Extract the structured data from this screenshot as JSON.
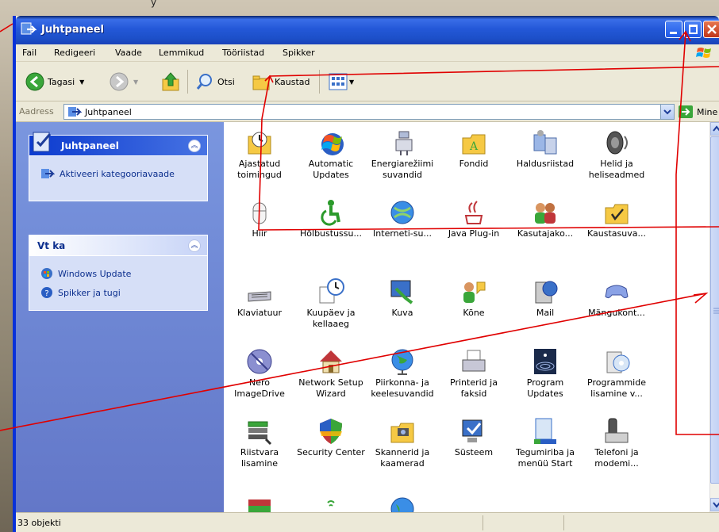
{
  "top_caption": "y",
  "window": {
    "title": "Juhtpaneel",
    "colors": {
      "titlebar": "#2458d8",
      "sidebar": "#6b83d1",
      "annotation": "#e00000"
    }
  },
  "menu": [
    "Fail",
    "Redigeeri",
    "Vaade",
    "Lemmikud",
    "Tööriistad",
    "Spikker"
  ],
  "toolbar": {
    "back": "Tagasi",
    "search": "Otsi",
    "folders": "Kaustad"
  },
  "address": {
    "label": "Aadress",
    "value": "Juhtpaneel",
    "go": "Mine"
  },
  "sidebar": {
    "box1": {
      "title": "Juhtpaneel",
      "link": "Aktiveeri kategooriavaade"
    },
    "box2": {
      "title": "Vt ka",
      "links": [
        "Windows Update",
        "Spikker ja tugi"
      ]
    }
  },
  "items": [
    {
      "label": "Ajastatud toimingud",
      "icon": "scheduled-tasks-icon"
    },
    {
      "label": "Automatic Updates",
      "icon": "automatic-updates-icon"
    },
    {
      "label": "Energiarežiimi suvandid",
      "icon": "power-options-icon"
    },
    {
      "label": "Fondid",
      "icon": "fonts-folder-icon"
    },
    {
      "label": "Haldusriistad",
      "icon": "admin-tools-icon"
    },
    {
      "label": "Helid ja heliseadmed",
      "icon": "speaker-icon"
    },
    {
      "label": "Hiir",
      "icon": "mouse-icon"
    },
    {
      "label": "Hõlbustussu...",
      "icon": "accessibility-icon"
    },
    {
      "label": "Interneti-su...",
      "icon": "internet-options-icon"
    },
    {
      "label": "Java Plug-in",
      "icon": "java-icon"
    },
    {
      "label": "Kasutajako...",
      "icon": "user-accounts-icon"
    },
    {
      "label": "Kaustasuva...",
      "icon": "folder-options-icon"
    },
    {
      "label": "Klaviatuur",
      "icon": "keyboard-icon"
    },
    {
      "label": "Kuupäev ja kellaaeg",
      "icon": "date-time-icon"
    },
    {
      "label": "Kuva",
      "icon": "display-icon"
    },
    {
      "label": "Kõne",
      "icon": "speech-icon"
    },
    {
      "label": "Mail",
      "icon": "mail-icon"
    },
    {
      "label": "Mängukont...",
      "icon": "game-controller-icon"
    },
    {
      "label": "Nero ImageDrive",
      "icon": "nero-disc-icon"
    },
    {
      "label": "Network Setup Wizard",
      "icon": "network-house-icon"
    },
    {
      "label": "Piirkonna- ja keelesuvandid",
      "icon": "globe-icon"
    },
    {
      "label": "Printerid ja faksid",
      "icon": "printer-icon"
    },
    {
      "label": "Program Updates",
      "icon": "program-updates-icon"
    },
    {
      "label": "Programmide lisamine v...",
      "icon": "add-remove-programs-icon"
    },
    {
      "label": "Riistvara lisamine",
      "icon": "add-hardware-icon"
    },
    {
      "label": "Security Center",
      "icon": "shield-icon"
    },
    {
      "label": "Skannerid ja kaamerad",
      "icon": "scanner-camera-icon"
    },
    {
      "label": "Süsteem",
      "icon": "system-icon"
    },
    {
      "label": "Tegumiriba ja menüü Start",
      "icon": "taskbar-icon"
    },
    {
      "label": "Telefoni ja modemi...",
      "icon": "phone-modem-icon"
    },
    {
      "label": "",
      "icon": "partial-icon-a"
    },
    {
      "label": "",
      "icon": "partial-icon-b"
    },
    {
      "label": "",
      "icon": "partial-icon-c"
    }
  ],
  "status": {
    "text": "33 objekti"
  }
}
